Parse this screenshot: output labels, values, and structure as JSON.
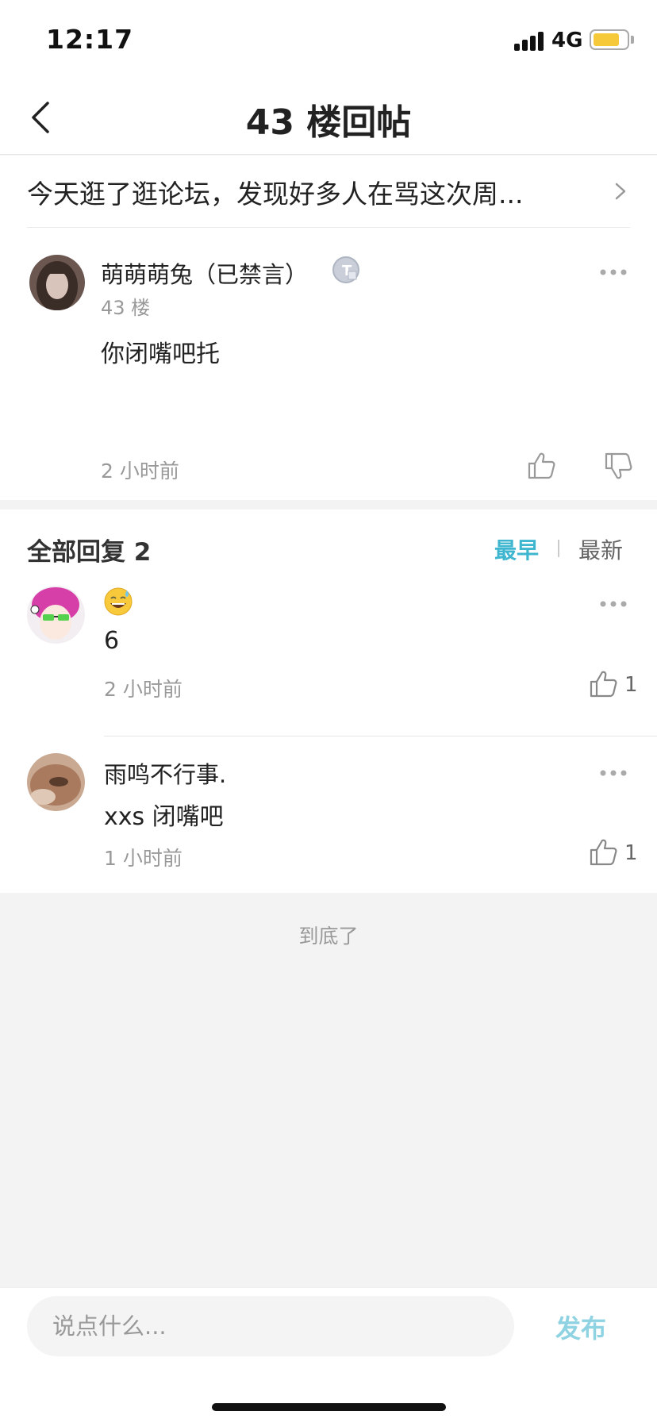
{
  "status_bar": {
    "time": "12:17",
    "network": "4G",
    "battery_level": 0.75
  },
  "nav": {
    "title": "43 楼回帖"
  },
  "thread": {
    "title": "今天逛了逛论坛，发现好多人在骂这次周..."
  },
  "main_post": {
    "author": "萌萌萌兔（已禁言）",
    "floor": "43 楼",
    "content": "你闭嘴吧托",
    "time": "2 小时前"
  },
  "replies": {
    "header": "全部回复 2",
    "sort_earliest": "最早",
    "sort_newest": "最新",
    "items": [
      {
        "name": "",
        "content": "6",
        "time": "2 小时前",
        "likes": "1",
        "emoji": "sweat-smile-emoji"
      },
      {
        "name": "雨鸣不行事.",
        "content": "xxs 闭嘴吧",
        "time": "1 小时前",
        "likes": "1"
      }
    ]
  },
  "footer": {
    "end_text": "到底了"
  },
  "composer": {
    "placeholder": "说点什么...",
    "publish_label": "发布"
  },
  "colors": {
    "accent": "#3fb6cf",
    "publish": "#8fd3e2",
    "battery": "#f5c93a"
  }
}
